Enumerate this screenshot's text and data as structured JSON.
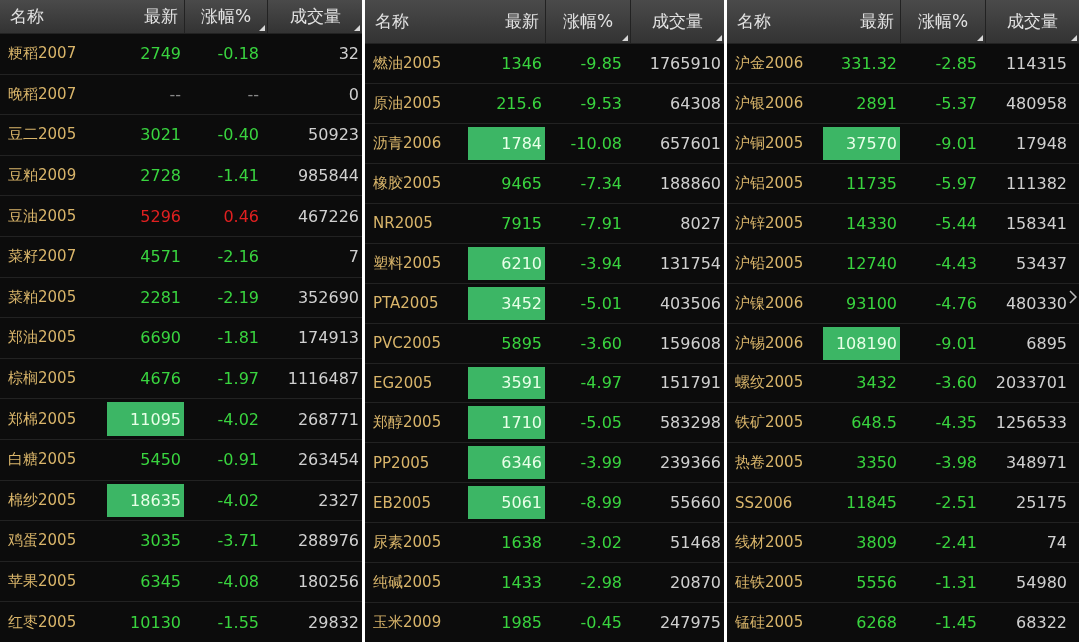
{
  "panels": [
    {
      "columns": [
        "名称",
        "最新",
        "涨幅%",
        "成交量"
      ],
      "rows": [
        {
          "name": "粳稻2007",
          "last": "2749",
          "change": "-0.18",
          "volume": "32",
          "kind": "down",
          "highlighted": false
        },
        {
          "name": "晚稻2007",
          "last": "--",
          "change": "--",
          "volume": "0",
          "kind": "flat",
          "highlighted": false
        },
        {
          "name": "豆二2005",
          "last": "3021",
          "change": "-0.40",
          "volume": "50923",
          "kind": "down",
          "highlighted": false
        },
        {
          "name": "豆粕2009",
          "last": "2728",
          "change": "-1.41",
          "volume": "985844",
          "kind": "down",
          "highlighted": false
        },
        {
          "name": "豆油2005",
          "last": "5296",
          "change": "0.46",
          "volume": "467226",
          "kind": "up",
          "highlighted": false
        },
        {
          "name": "菜籽2007",
          "last": "4571",
          "change": "-2.16",
          "volume": "7",
          "kind": "down",
          "highlighted": false
        },
        {
          "name": "菜粕2005",
          "last": "2281",
          "change": "-2.19",
          "volume": "352690",
          "kind": "down",
          "highlighted": false
        },
        {
          "name": "郑油2005",
          "last": "6690",
          "change": "-1.81",
          "volume": "174913",
          "kind": "down",
          "highlighted": false
        },
        {
          "name": "棕榈2005",
          "last": "4676",
          "change": "-1.97",
          "volume": "1116487",
          "kind": "down",
          "highlighted": false
        },
        {
          "name": "郑棉2005",
          "last": "11095",
          "change": "-4.02",
          "volume": "268771",
          "kind": "down",
          "highlighted": true
        },
        {
          "name": "白糖2005",
          "last": "5450",
          "change": "-0.91",
          "volume": "263454",
          "kind": "down",
          "highlighted": false
        },
        {
          "name": "棉纱2005",
          "last": "18635",
          "change": "-4.02",
          "volume": "2327",
          "kind": "down",
          "highlighted": true
        },
        {
          "name": "鸡蛋2005",
          "last": "3035",
          "change": "-3.71",
          "volume": "288976",
          "kind": "down",
          "highlighted": false
        },
        {
          "name": "苹果2005",
          "last": "6345",
          "change": "-4.08",
          "volume": "180256",
          "kind": "down",
          "highlighted": false
        },
        {
          "name": "红枣2005",
          "last": "10130",
          "change": "-1.55",
          "volume": "29832",
          "kind": "down",
          "highlighted": false
        }
      ]
    },
    {
      "columns": [
        "名称",
        "最新",
        "涨幅%",
        "成交量"
      ],
      "rows": [
        {
          "name": "燃油2005",
          "last": "1346",
          "change": "-9.85",
          "volume": "1765910",
          "kind": "down",
          "highlighted": false
        },
        {
          "name": "原油2005",
          "last": "215.6",
          "change": "-9.53",
          "volume": "64308",
          "kind": "down",
          "highlighted": false
        },
        {
          "name": "沥青2006",
          "last": "1784",
          "change": "-10.08",
          "volume": "657601",
          "kind": "down",
          "highlighted": true
        },
        {
          "name": "橡胶2005",
          "last": "9465",
          "change": "-7.34",
          "volume": "188860",
          "kind": "down",
          "highlighted": false
        },
        {
          "name": "NR2005",
          "last": "7915",
          "change": "-7.91",
          "volume": "8027",
          "kind": "down",
          "highlighted": false
        },
        {
          "name": "塑料2005",
          "last": "6210",
          "change": "-3.94",
          "volume": "131754",
          "kind": "down",
          "highlighted": true
        },
        {
          "name": "PTA2005",
          "last": "3452",
          "change": "-5.01",
          "volume": "403506",
          "kind": "down",
          "highlighted": true
        },
        {
          "name": "PVC2005",
          "last": "5895",
          "change": "-3.60",
          "volume": "159608",
          "kind": "down",
          "highlighted": false
        },
        {
          "name": "EG2005",
          "last": "3591",
          "change": "-4.97",
          "volume": "151791",
          "kind": "down",
          "highlighted": true
        },
        {
          "name": "郑醇2005",
          "last": "1710",
          "change": "-5.05",
          "volume": "583298",
          "kind": "down",
          "highlighted": true
        },
        {
          "name": "PP2005",
          "last": "6346",
          "change": "-3.99",
          "volume": "239366",
          "kind": "down",
          "highlighted": true
        },
        {
          "name": "EB2005",
          "last": "5061",
          "change": "-8.99",
          "volume": "55660",
          "kind": "down",
          "highlighted": true
        },
        {
          "name": "尿素2005",
          "last": "1638",
          "change": "-3.02",
          "volume": "51468",
          "kind": "down",
          "highlighted": false
        },
        {
          "name": "纯碱2005",
          "last": "1433",
          "change": "-2.98",
          "volume": "20870",
          "kind": "down",
          "highlighted": false
        },
        {
          "name": "玉米2009",
          "last": "1985",
          "change": "-0.45",
          "volume": "247975",
          "kind": "down",
          "highlighted": false
        }
      ]
    },
    {
      "columns": [
        "名称",
        "最新",
        "涨幅%",
        "成交量"
      ],
      "rows": [
        {
          "name": "沪金2006",
          "last": "331.32",
          "change": "-2.85",
          "volume": "114315",
          "kind": "down",
          "highlighted": false
        },
        {
          "name": "沪银2006",
          "last": "2891",
          "change": "-5.37",
          "volume": "480958",
          "kind": "down",
          "highlighted": false
        },
        {
          "name": "沪铜2005",
          "last": "37570",
          "change": "-9.01",
          "volume": "17948",
          "kind": "down",
          "highlighted": true
        },
        {
          "name": "沪铝2005",
          "last": "11735",
          "change": "-5.97",
          "volume": "111382",
          "kind": "down",
          "highlighted": false
        },
        {
          "name": "沪锌2005",
          "last": "14330",
          "change": "-5.44",
          "volume": "158341",
          "kind": "down",
          "highlighted": false
        },
        {
          "name": "沪铅2005",
          "last": "12740",
          "change": "-4.43",
          "volume": "53437",
          "kind": "down",
          "highlighted": false
        },
        {
          "name": "沪镍2006",
          "last": "93100",
          "change": "-4.76",
          "volume": "480330",
          "kind": "down",
          "highlighted": false
        },
        {
          "name": "沪锡2006",
          "last": "108190",
          "change": "-9.01",
          "volume": "6895",
          "kind": "down",
          "highlighted": true
        },
        {
          "name": "螺纹2005",
          "last": "3432",
          "change": "-3.60",
          "volume": "2033701",
          "kind": "down",
          "highlighted": false
        },
        {
          "name": "铁矿2005",
          "last": "648.5",
          "change": "-4.35",
          "volume": "1256533",
          "kind": "down",
          "highlighted": false
        },
        {
          "name": "热卷2005",
          "last": "3350",
          "change": "-3.98",
          "volume": "348971",
          "kind": "down",
          "highlighted": false
        },
        {
          "name": "SS2006",
          "last": "11845",
          "change": "-2.51",
          "volume": "25175",
          "kind": "down",
          "highlighted": false
        },
        {
          "name": "线材2005",
          "last": "3809",
          "change": "-2.41",
          "volume": "74",
          "kind": "down",
          "highlighted": false
        },
        {
          "name": "硅铁2005",
          "last": "5556",
          "change": "-1.31",
          "volume": "54980",
          "kind": "down",
          "highlighted": false
        },
        {
          "name": "锰硅2005",
          "last": "6268",
          "change": "-1.45",
          "volume": "68322",
          "kind": "down",
          "highlighted": false
        }
      ]
    }
  ]
}
